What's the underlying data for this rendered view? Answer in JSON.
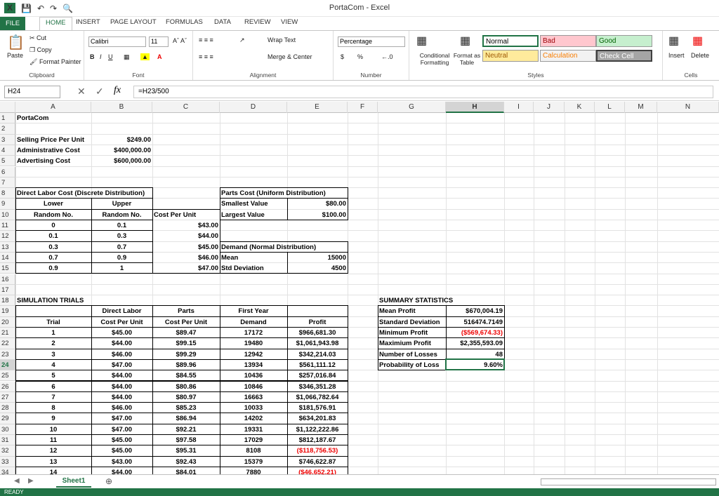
{
  "app": {
    "title": "PortaCom - Excel"
  },
  "tabs": [
    "FILE",
    "HOME",
    "INSERT",
    "PAGE LAYOUT",
    "FORMULAS",
    "DATA",
    "REVIEW",
    "VIEW"
  ],
  "ribbon": {
    "clipboard": {
      "label": "Clipboard",
      "paste": "Paste",
      "cut": "Cut",
      "copy": "Copy",
      "painter": "Format Painter"
    },
    "font": {
      "label": "Font",
      "name": "Calibri",
      "size": "11"
    },
    "alignment": {
      "label": "Alignment",
      "wrap": "Wrap Text",
      "merge": "Merge & Center"
    },
    "number": {
      "label": "Number",
      "format": "Percentage",
      "currency": "$",
      "percent": "%"
    },
    "styles": {
      "label": "Styles",
      "conditional": "Conditional Formatting",
      "format_table": "Format as Table",
      "normal": "Normal",
      "bad": "Bad",
      "good": "Good",
      "neutral": "Neutral",
      "calculation": "Calculation",
      "check": "Check Cell"
    },
    "cells": {
      "label": "Cells",
      "insert": "Insert",
      "delete": "Delete"
    }
  },
  "formula_bar": {
    "name_box": "H24",
    "formula": "=H23/500",
    "fx": "fx"
  },
  "columns": [
    "A",
    "B",
    "C",
    "D",
    "E",
    "F",
    "G",
    "H",
    "I",
    "J",
    "K",
    "L",
    "M",
    "N"
  ],
  "selected_column": "H",
  "selected_row": 24,
  "rows": [
    1,
    2,
    3,
    4,
    5,
    6,
    7,
    8,
    9,
    10,
    11,
    12,
    13,
    14,
    15,
    16,
    17,
    18,
    19,
    20,
    21,
    22,
    23,
    24,
    25,
    26,
    27,
    28,
    29,
    30,
    31,
    32,
    33,
    34
  ],
  "sheet": {
    "A1": "PortaCom",
    "A3": "Selling Price Per Unit",
    "B3": "$249.00",
    "A4": "Administrative Cost",
    "B4": "$400,000.00",
    "A5": "Advertising Cost",
    "B5": "$600,000.00",
    "A8": "Direct Labor Cost (Discrete Distribution)",
    "A9": "Lower",
    "B9": "Upper",
    "A10": "Random No.",
    "B10": "Random No.",
    "C10": "Cost Per Unit",
    "D8": "Parts Cost (Uniform Distribution)",
    "D9": "Smallest Value",
    "E9": "$80.00",
    "D10": "Largest Value",
    "E10": "$100.00",
    "labor": [
      [
        "0",
        "0.1",
        "$43.00"
      ],
      [
        "0.1",
        "0.3",
        "$44.00"
      ],
      [
        "0.3",
        "0.7",
        "$45.00"
      ],
      [
        "0.7",
        "0.9",
        "$46.00"
      ],
      [
        "0.9",
        "1",
        "$47.00"
      ]
    ],
    "D13": "Demand (Normal Distribution)",
    "D14": "Mean",
    "E14": "15000",
    "D15": "Std Deviation",
    "E15": "4500",
    "A18": "SIMULATION TRIALS",
    "B19": "Direct Labor",
    "C19": "Parts",
    "D19": "First Year",
    "A20": "Trial",
    "B20": "Cost Per Unit",
    "C20": "Cost Per Unit",
    "D20": "Demand",
    "E20": "Profit",
    "trials": [
      [
        "1",
        "$45.00",
        "$89.47",
        "17172",
        "$966,681.30",
        false
      ],
      [
        "2",
        "$44.00",
        "$99.15",
        "19480",
        "$1,061,943.98",
        false
      ],
      [
        "3",
        "$46.00",
        "$99.29",
        "12942",
        "$342,214.03",
        false
      ],
      [
        "4",
        "$47.00",
        "$89.96",
        "13934",
        "$561,111.12",
        false
      ],
      [
        "5",
        "$44.00",
        "$84.55",
        "10436",
        "$257,016.84",
        false
      ],
      [
        "6",
        "$44.00",
        "$80.86",
        "10846",
        "$346,351.28",
        false
      ],
      [
        "7",
        "$44.00",
        "$80.97",
        "16663",
        "$1,066,782.64",
        false
      ],
      [
        "8",
        "$46.00",
        "$85.23",
        "10033",
        "$181,576.91",
        false
      ],
      [
        "9",
        "$47.00",
        "$86.94",
        "14202",
        "$634,201.83",
        false
      ],
      [
        "10",
        "$47.00",
        "$92.21",
        "19331",
        "$1,122,222.86",
        false
      ],
      [
        "11",
        "$45.00",
        "$97.58",
        "17029",
        "$812,187.67",
        false
      ],
      [
        "12",
        "$45.00",
        "$95.31",
        "8108",
        "($118,756.53)",
        true
      ],
      [
        "13",
        "$43.00",
        "$92.43",
        "15379",
        "$746,622.87",
        false
      ],
      [
        "14",
        "$44.00",
        "$84.01",
        "7880",
        "($46,652.21)",
        true
      ]
    ],
    "G18": "SUMMARY STATISTICS",
    "summary": [
      [
        "Mean Profit",
        "$670,004.19",
        false
      ],
      [
        "Standard Deviation",
        "516474.7149",
        false
      ],
      [
        "Minimum Profit",
        "($569,674.33)",
        true
      ],
      [
        "Maximium Profit",
        "$2,355,593.09",
        false
      ],
      [
        "Number of Losses",
        "48",
        false
      ],
      [
        "Probability of Loss",
        "9.60%",
        false
      ]
    ]
  },
  "sheet_tab": "Sheet1",
  "status": "READY"
}
